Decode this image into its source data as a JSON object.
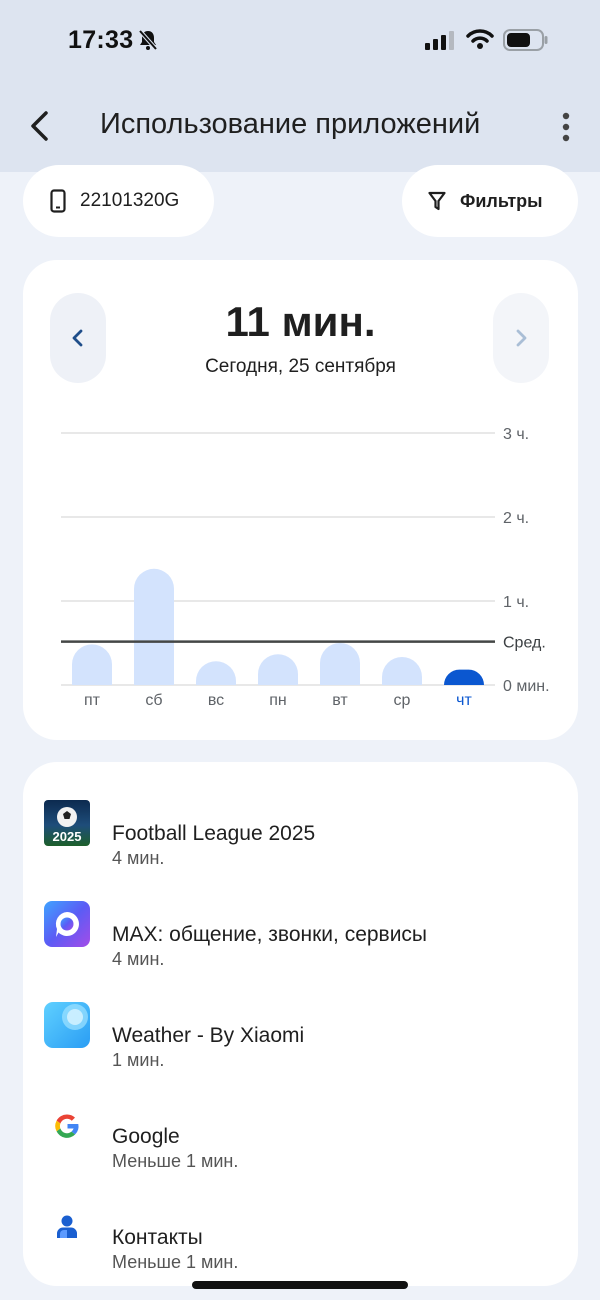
{
  "status_bar": {
    "time": "17:33"
  },
  "header": {
    "title": "Использование приложений"
  },
  "chips": {
    "device": "22101320G",
    "filters": "Фильтры"
  },
  "summary": {
    "total": "11 мин.",
    "date": "Сегодня, 25 сентября"
  },
  "colors": {
    "bar": "#d3e3fd",
    "selected_bar": "#0b57d0",
    "average_line": "#444746",
    "grid": "#e0e0e0"
  },
  "chart_data": {
    "type": "bar",
    "categories": [
      "пт",
      "сб",
      "вс",
      "пн",
      "вт",
      "ср",
      "чт"
    ],
    "values_minutes": [
      29,
      83,
      17,
      22,
      30,
      20,
      11
    ],
    "selected_index": 6,
    "average_minutes": 31,
    "average_label": "Сред.",
    "y_ticks_minutes": [
      0,
      60,
      120,
      180
    ],
    "y_tick_labels": [
      "0 мин.",
      "1 ч.",
      "2 ч.",
      "3 ч."
    ],
    "ylim": [
      0,
      180
    ]
  },
  "apps": [
    {
      "name": "Football League 2025",
      "time": "4 мин.",
      "icon": "football-league-icon",
      "badge": "2025"
    },
    {
      "name": "MAX: общение, звонки, сервисы",
      "time": "4 мин.",
      "icon": "max-messenger-icon"
    },
    {
      "name": "Weather - By Xiaomi",
      "time": "1 мин.",
      "icon": "weather-icon"
    },
    {
      "name": "Google",
      "time": "Меньше 1 мин.",
      "icon": "google-icon"
    },
    {
      "name": "Контакты",
      "time": "Меньше 1 мин.",
      "icon": "contacts-icon"
    }
  ]
}
